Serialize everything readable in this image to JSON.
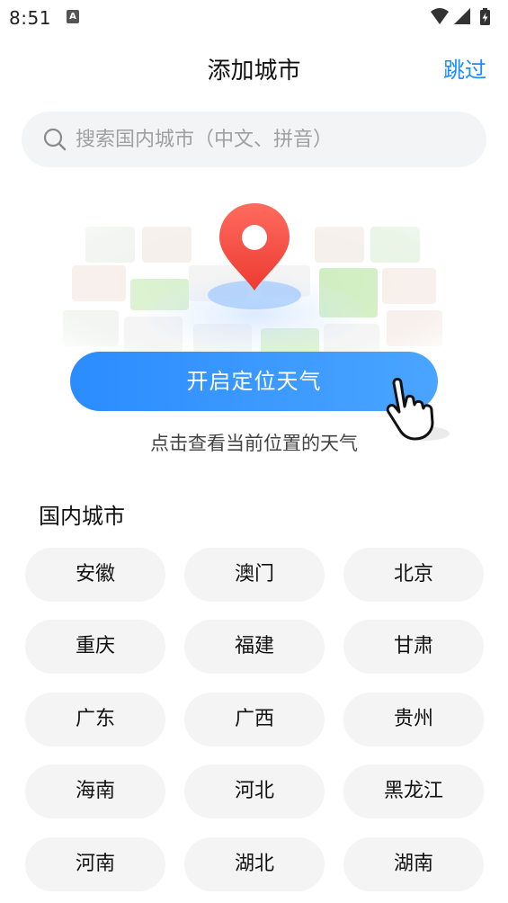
{
  "status_bar": {
    "time": "8:51",
    "app_icon_letter": "A"
  },
  "header": {
    "title": "添加城市",
    "skip_label": "跳过"
  },
  "search": {
    "placeholder": "搜索国内城市（中文、拼音）",
    "value": ""
  },
  "location": {
    "button_label": "开启定位天气",
    "hint": "点击查看当前位置的天气"
  },
  "domestic": {
    "section_title": "国内城市",
    "cities": [
      "安徽",
      "澳门",
      "北京",
      "重庆",
      "福建",
      "甘肃",
      "广东",
      "广西",
      "贵州",
      "海南",
      "河北",
      "黑龙江",
      "河南",
      "湖北",
      "湖南"
    ]
  },
  "colors": {
    "accent": "#1a8cff",
    "button_start": "#2b8cff",
    "button_end": "#4aa5ff",
    "pin_red": "#f04a3e",
    "chip_bg": "#f4f4f5"
  }
}
